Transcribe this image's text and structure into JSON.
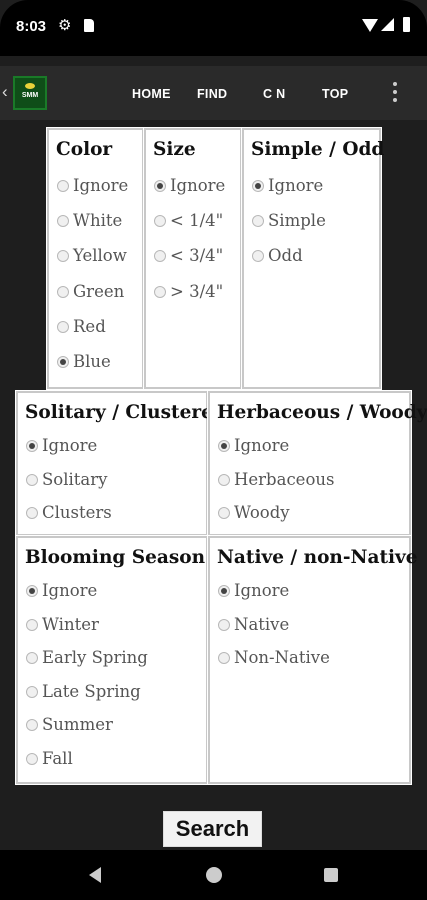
{
  "status": {
    "time": "8:03"
  },
  "nav": {
    "items": [
      "HOME",
      "FIND",
      "C N",
      "TOP"
    ],
    "logo_text": "SMM"
  },
  "filters": {
    "color": {
      "title": "Color",
      "options": [
        "Ignore",
        "White",
        "Yellow",
        "Green",
        "Red",
        "Blue"
      ],
      "selected": "Blue"
    },
    "size": {
      "title": "Size",
      "options": [
        "Ignore",
        "< 1/4\"",
        "< 3/4\"",
        "> 3/4\""
      ],
      "selected": "Ignore"
    },
    "simple_odd": {
      "title": "Simple / Odd",
      "options": [
        "Ignore",
        "Simple",
        "Odd"
      ],
      "selected": "Ignore"
    },
    "solitary_clustered": {
      "title": "Solitary / Clustered",
      "options": [
        "Ignore",
        "Solitary",
        "Clusters"
      ],
      "selected": "Ignore"
    },
    "herbaceous_woody": {
      "title": "Herbaceous / Woody",
      "options": [
        "Ignore",
        "Herbaceous",
        "Woody"
      ],
      "selected": "Ignore"
    },
    "blooming_season": {
      "title": "Blooming Season",
      "options": [
        "Ignore",
        "Winter",
        "Early Spring",
        "Late Spring",
        "Summer",
        "Fall"
      ],
      "selected": "Ignore"
    },
    "native": {
      "title": "Native / non-Native",
      "options": [
        "Ignore",
        "Native",
        "Non-Native"
      ],
      "selected": "Ignore"
    }
  },
  "search": {
    "label": "Search"
  }
}
